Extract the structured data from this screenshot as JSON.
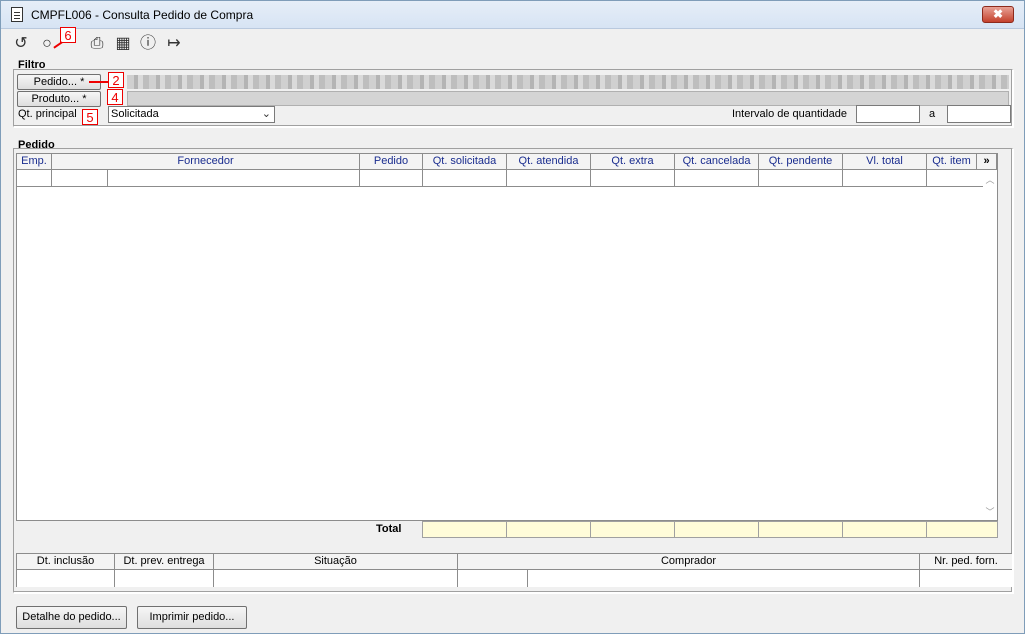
{
  "window": {
    "title": "CMPFL006 - Consulta Pedido de Compra",
    "close_label": "✖"
  },
  "toolbar": {
    "undo_icon": "undo-icon",
    "search_icon": "search-icon",
    "print_icon": "printer-icon",
    "calendar_icon": "calendar-icon",
    "help_icon": "help-icon",
    "exit_icon": "exit-icon"
  },
  "markers": {
    "m2": "2",
    "m4": "4",
    "m5": "5",
    "m6": "6"
  },
  "filter": {
    "group_label": "Filtro",
    "pedido_button": "Pedido... *",
    "produto_button": "Produto... *",
    "qt_principal_label": "Qt. principal",
    "qt_principal_value": "Solicitada",
    "intervalo_label": "Intervalo de quantidade",
    "a_label": "a"
  },
  "pedido": {
    "group_label": "Pedido",
    "columns": [
      "Emp.",
      "Fornecedor",
      "Pedido",
      "Qt. solicitada",
      "Qt. atendida",
      "Qt. extra",
      "Qt. cancelada",
      "Qt. pendente",
      "Vl. total",
      "Qt. item"
    ],
    "more_label": "»",
    "total_label": "Total"
  },
  "details": {
    "columns": [
      "Dt. inclusão",
      "Dt. prev. entrega",
      "Situação",
      "Comprador",
      "Nr. ped. forn."
    ]
  },
  "footer": {
    "detalhe_button": "Detalhe do pedido...",
    "imprimir_button": "Imprimir pedido..."
  }
}
